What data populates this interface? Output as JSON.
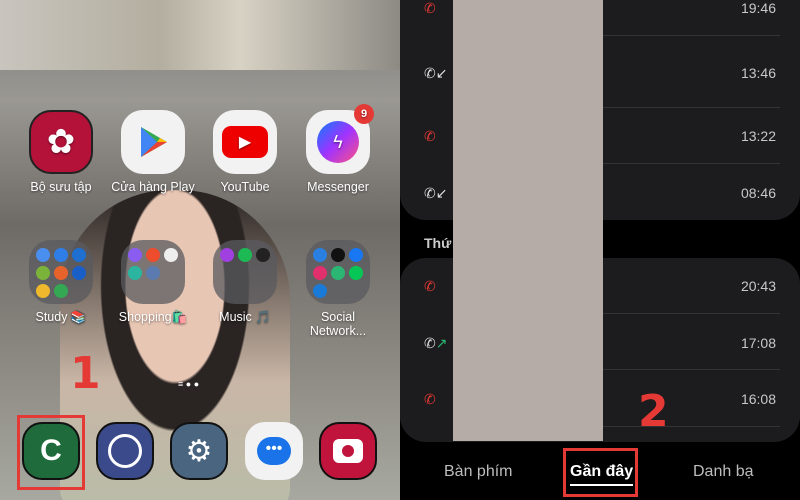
{
  "home": {
    "apps": [
      {
        "label": "Bộ sưu tập",
        "icon": "gallery-icon"
      },
      {
        "label": "Cửa hàng Play",
        "icon": "play-store-icon"
      },
      {
        "label": "YouTube",
        "icon": "youtube-icon"
      },
      {
        "label": "Messenger",
        "icon": "messenger-icon",
        "badge": "9"
      }
    ],
    "folders": [
      {
        "label": "Study 📚"
      },
      {
        "label": "Shopping🛍️"
      },
      {
        "label": "Music 🎵"
      },
      {
        "label": "Social Network..."
      }
    ],
    "dock": [
      {
        "icon": "phone-icon"
      },
      {
        "icon": "clock-icon"
      },
      {
        "icon": "settings-icon"
      },
      {
        "icon": "messages-icon"
      },
      {
        "icon": "camera-icon"
      }
    ],
    "step_label": "1"
  },
  "recents": {
    "group1": [
      {
        "type": "missed",
        "time": "19:46"
      },
      {
        "type": "incoming",
        "time": "13:46"
      },
      {
        "type": "missed",
        "time": "13:22"
      },
      {
        "type": "incoming",
        "time": "08:46"
      }
    ],
    "section_header": "Thứ",
    "group2": [
      {
        "type": "missed",
        "time": "20:43"
      },
      {
        "type": "outgoing",
        "time": "17:08"
      },
      {
        "type": "missed",
        "time": "16:08"
      }
    ],
    "tabs": {
      "keypad": "Bàn phím",
      "recents": "Gần đây",
      "contacts": "Danh bạ"
    },
    "step_label": "2",
    "colors": {
      "missed": "#e53935",
      "outgoing": "#2bb673",
      "accent": "#e53935"
    }
  }
}
